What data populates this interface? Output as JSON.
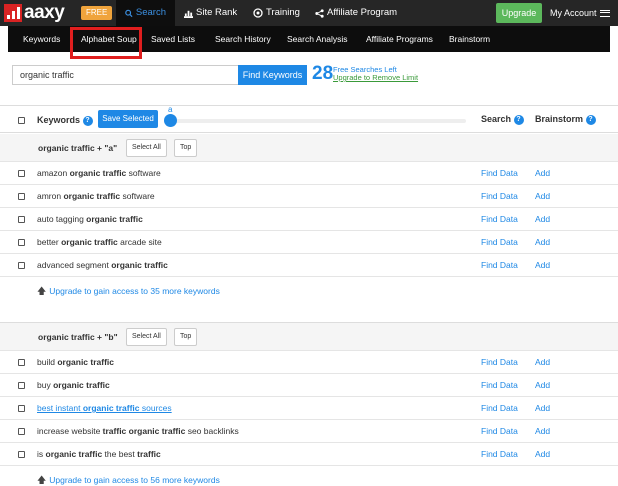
{
  "brand": {
    "name": "aaxy",
    "badge": "FREE",
    "accent": "#1e88e5",
    "logo_color": "#d92323"
  },
  "nav": {
    "items": [
      {
        "label": "Search",
        "icon": "search-icon",
        "active": true
      },
      {
        "label": "Site Rank",
        "icon": "bar-chart-icon"
      },
      {
        "label": "Training",
        "icon": "target-icon"
      },
      {
        "label": "Affiliate Program",
        "icon": "share-icon"
      }
    ],
    "upgrade": "Upgrade",
    "account": "My Account"
  },
  "subnav": [
    "Keywords",
    "Alphabet Soup",
    "Saved Lists",
    "Search History",
    "Search Analysis",
    "Affiliate Programs",
    "Brainstorm"
  ],
  "search": {
    "value": "organic traffic",
    "button": "Find Keywords",
    "count": "28",
    "free_left": "Free Searches Left",
    "upgrade_link": "Upgrade to Remove Limit"
  },
  "table": {
    "col_keywords": "Keywords",
    "save_selected": "Save Selected",
    "slider_label": "a",
    "col_search": "Search",
    "col_brainstorm": "Brainstorm"
  },
  "groups": [
    {
      "title": "organic traffic + \"a\"",
      "select_all": "Select All",
      "top": "Top",
      "rows": [
        {
          "parts": [
            "amazon ",
            "organic traffic",
            " software"
          ]
        },
        {
          "parts": [
            "amron ",
            "organic traffic",
            " software"
          ]
        },
        {
          "parts": [
            "auto tagging ",
            "organic traffic",
            ""
          ]
        },
        {
          "parts": [
            "better ",
            "organic traffic",
            " arcade site"
          ]
        },
        {
          "parts": [
            "advanced segment ",
            "organic traffic",
            ""
          ]
        }
      ],
      "more": "Upgrade to gain access to 35 more keywords"
    },
    {
      "title": "organic traffic + \"b\"",
      "select_all": "Select All",
      "top": "Top",
      "rows": [
        {
          "parts": [
            "build ",
            "organic traffic",
            ""
          ]
        },
        {
          "parts": [
            "buy ",
            "organic traffic",
            ""
          ]
        },
        {
          "parts": [
            "best instant ",
            "organic traffic",
            " sources"
          ],
          "link": true
        },
        {
          "parts": [
            "increase website ",
            "traffic organic traffic",
            " seo backlinks"
          ]
        },
        {
          "parts": [
            "is ",
            "organic traffic",
            " the best ",
            "traffic"
          ]
        }
      ],
      "more": "Upgrade to gain access to 56 more keywords"
    }
  ],
  "row_find": "Find Data",
  "row_add": "Add"
}
